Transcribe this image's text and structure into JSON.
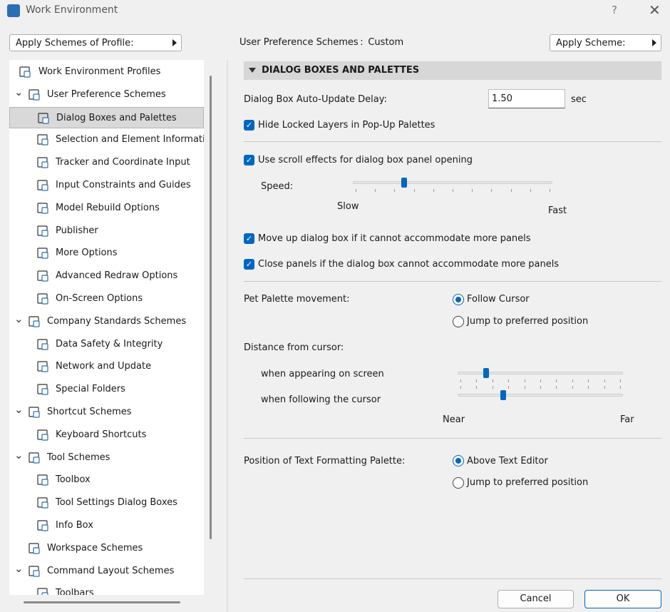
{
  "window": {
    "title": "Work Environment",
    "help_label": "?",
    "close_label": "✕"
  },
  "profile_button": {
    "label": "Apply Schemes of Profile:"
  },
  "scheme_header": {
    "label": "User Preference Schemes :  Custom"
  },
  "apply_scheme_button": {
    "label": "Apply Scheme:"
  },
  "tree": {
    "items": [
      {
        "label": "Work Environment Profiles",
        "icon": "profiles-icon"
      },
      {
        "label": "User Preference Schemes",
        "icon": "user-scheme-icon"
      },
      {
        "label": "Dialog Boxes and Palettes",
        "icon": "dialog-palette-icon"
      },
      {
        "label": "Selection and Element Informatic",
        "icon": "selection-info-icon"
      },
      {
        "label": "Tracker and Coordinate Input",
        "icon": "xyz-icon"
      },
      {
        "label": "Input Constraints and Guides",
        "icon": "mouse-constraint-icon"
      },
      {
        "label": "Model Rebuild Options",
        "icon": "bricks-icon"
      },
      {
        "label": "Publisher",
        "icon": "publisher-icon"
      },
      {
        "label": "More Options",
        "icon": "sliders-icon"
      },
      {
        "label": "Advanced Redraw Options",
        "icon": "house-redraw-icon"
      },
      {
        "label": "On-Screen Options",
        "icon": "screen-options-icon"
      },
      {
        "label": "Company Standards Schemes",
        "icon": "company-scheme-icon"
      },
      {
        "label": "Data Safety & Integrity",
        "icon": "data-safety-icon"
      },
      {
        "label": "Network and Update",
        "icon": "globe-icon"
      },
      {
        "label": "Special Folders",
        "icon": "folder-icon"
      },
      {
        "label": "Shortcut Schemes",
        "icon": "shortcut-scheme-icon"
      },
      {
        "label": "Keyboard Shortcuts",
        "icon": "keyboard-shortcut-icon"
      },
      {
        "label": "Tool Schemes",
        "icon": "tool-scheme-icon"
      },
      {
        "label": "Toolbox",
        "icon": "toolbox-icon"
      },
      {
        "label": "Tool Settings Dialog Boxes",
        "icon": "tool-settings-icon"
      },
      {
        "label": "Info Box",
        "icon": "info-box-icon"
      },
      {
        "label": "Workspace Schemes",
        "icon": "workspace-icon"
      },
      {
        "label": "Command Layout Schemes",
        "icon": "command-layout-icon"
      },
      {
        "label": "Toolbars",
        "icon": "toolbars-icon"
      }
    ]
  },
  "section": {
    "title": "DIALOG BOXES AND PALETTES",
    "delay_label": "Dialog Box Auto-Update Delay:",
    "delay_value": "1.50",
    "delay_unit": "sec",
    "hide_locked_label": "Hide Locked Layers in Pop-Up Palettes",
    "hide_locked_checked": true,
    "scroll_effects_label": "Use scroll effects for dialog box panel opening",
    "scroll_effects_checked": true,
    "speed_label": "Speed:",
    "speed_min_label": "Slow",
    "speed_max_label": "Fast",
    "speed_value": 0.25,
    "move_up_label": "Move up dialog box if it cannot accommodate more panels",
    "move_up_checked": true,
    "close_panels_label": "Close panels if the dialog box cannot accommodate more panels",
    "close_panels_checked": true,
    "pet_palette_label": "Pet Palette movement:",
    "pet_options": [
      "Follow Cursor",
      "Jump to preferred position"
    ],
    "pet_selected": "Follow Cursor",
    "distance_label": "Distance from cursor:",
    "appearing_label": "when appearing on screen",
    "appearing_value": 0.16,
    "following_label": "when following the cursor",
    "following_value": 0.27,
    "near_label": "Near",
    "far_label": "Far",
    "text_palette_label": "Position of Text Formatting Palette:",
    "text_palette_options": [
      "Above Text Editor",
      "Jump to preferred position"
    ],
    "text_palette_selected": "Above Text Editor"
  },
  "footer": {
    "cancel_label": "Cancel",
    "ok_label": "OK"
  },
  "colors": {
    "accent": "#0067c0",
    "selected_row": "#d9d9d9",
    "header_band": "#d7d7d7"
  }
}
